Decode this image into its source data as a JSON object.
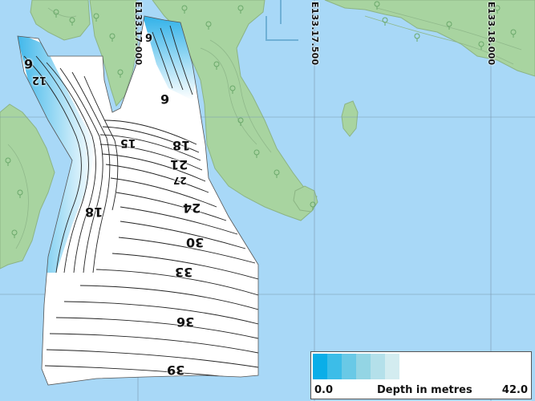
{
  "map": {
    "water_color": "#a8d8f7",
    "land_color": "#a8d4a0",
    "grid_labels": [
      "E133.17.000",
      "E133.17.500",
      "E133.18.000"
    ],
    "depth_labels": [
      "6",
      "6",
      "6",
      "12",
      "15",
      "18",
      "18",
      "21",
      "24",
      "27",
      "30",
      "33",
      "36",
      "39"
    ],
    "tree_symbol": "tree-icon"
  },
  "legend": {
    "min_label": "0.0",
    "title": "Depth in metres",
    "max_label": "42.0",
    "ramp_colors": [
      "#0aaee8",
      "#3cbde8",
      "#69c9e6",
      "#93d5e4",
      "#b4e0ea",
      "#d3ecf0",
      "#ffffff"
    ]
  }
}
